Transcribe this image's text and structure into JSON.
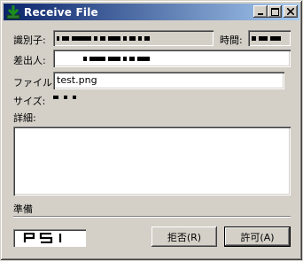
{
  "window": {
    "title": "Receive File",
    "buttons": {
      "minimize": "_",
      "maximize": "□",
      "close": "×"
    }
  },
  "form": {
    "id_label": "識別子:",
    "time_label": "時間:",
    "sender_label": "差出人:",
    "file_label": "ファイル:",
    "file_value": "test.png",
    "size_label": "サイズ:",
    "details_label": "詳細:",
    "details_value": ""
  },
  "status": {
    "text": "準備"
  },
  "actions": {
    "reject_label": "拒否(R)",
    "accept_label": "許可(A)"
  },
  "logo": {
    "text": "PSI"
  }
}
